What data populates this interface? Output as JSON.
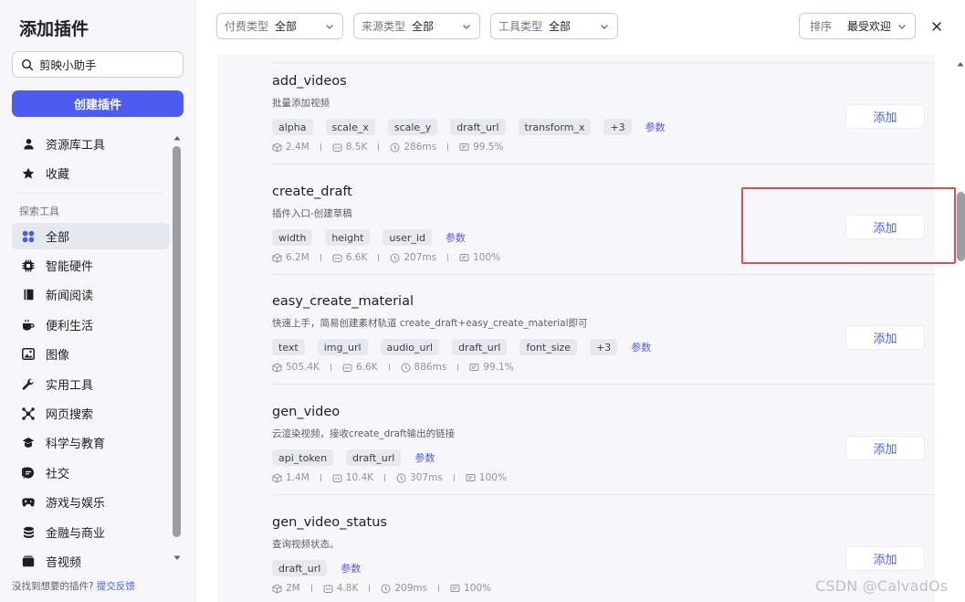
{
  "sidebar": {
    "title": "添加插件",
    "search_value": "剪映小助手",
    "create_label": "创建插件",
    "items_top": [
      {
        "label": "资源库工具",
        "icon": "person-icon"
      },
      {
        "label": "收藏",
        "icon": "star-icon"
      }
    ],
    "section_label": "探索工具",
    "categories": [
      {
        "label": "全部",
        "icon": "grid-icon",
        "active": true
      },
      {
        "label": "智能硬件",
        "icon": "chip-icon"
      },
      {
        "label": "新闻阅读",
        "icon": "book-icon"
      },
      {
        "label": "便利生活",
        "icon": "cup-icon"
      },
      {
        "label": "图像",
        "icon": "image-icon"
      },
      {
        "label": "实用工具",
        "icon": "wrench-icon"
      },
      {
        "label": "网页搜索",
        "icon": "network-icon"
      },
      {
        "label": "科学与教育",
        "icon": "flask-icon"
      },
      {
        "label": "社交",
        "icon": "chat-icon"
      },
      {
        "label": "游戏与娱乐",
        "icon": "gamepad-icon"
      },
      {
        "label": "金融与商业",
        "icon": "coins-icon"
      },
      {
        "label": "音视频",
        "icon": "media-icon"
      }
    ],
    "footer_text": "没找到想要的插件?",
    "footer_link": "提交反馈"
  },
  "filters": [
    {
      "label": "付费类型",
      "value": "全部"
    },
    {
      "label": "来源类型",
      "value": "全部"
    },
    {
      "label": "工具类型",
      "value": "全部"
    }
  ],
  "sort": {
    "label": "排序",
    "value": "最受欢迎"
  },
  "plugins": [
    {
      "name": "add_videos",
      "desc": "批量添加视频",
      "tags": [
        "alpha",
        "scale_x",
        "scale_y",
        "draft_url",
        "transform_x"
      ],
      "more": "+3",
      "params": "参数",
      "stats": {
        "downloads": "2.4M",
        "bots": "8.5K",
        "latency": "286ms",
        "success": "99.5%"
      },
      "add": "添加"
    },
    {
      "name": "create_draft",
      "desc": "插件入口-创建草稿",
      "tags": [
        "width",
        "height",
        "user_id"
      ],
      "more": "",
      "params": "参数",
      "stats": {
        "downloads": "6.2M",
        "bots": "6.6K",
        "latency": "207ms",
        "success": "100%"
      },
      "add": "添加"
    },
    {
      "name": "easy_create_material",
      "desc": "快速上手，简易创建素材轨道 create_draft+easy_create_material即可",
      "tags": [
        "text",
        "img_url",
        "audio_url",
        "draft_url",
        "font_size"
      ],
      "more": "+3",
      "params": "参数",
      "stats": {
        "downloads": "505.4K",
        "bots": "6.6K",
        "latency": "886ms",
        "success": "99.1%"
      },
      "add": "添加"
    },
    {
      "name": "gen_video",
      "desc": "云渲染视频，接收create_draft输出的链接",
      "tags": [
        "api_token",
        "draft_url"
      ],
      "more": "",
      "params": "参数",
      "stats": {
        "downloads": "1.4M",
        "bots": "10.4K",
        "latency": "307ms",
        "success": "100%"
      },
      "add": "添加"
    },
    {
      "name": "gen_video_status",
      "desc": "查询视频状态。",
      "tags": [
        "draft_url"
      ],
      "more": "",
      "params": "参数",
      "stats": {
        "downloads": "2M",
        "bots": "4.8K",
        "latency": "209ms",
        "success": "100%"
      },
      "add": "添加"
    }
  ],
  "watermark": "CSDN @CalvadOs",
  "colors": {
    "accent": "#4c5cf0",
    "highlight_border": "#e14b53",
    "panel_bg": "#f7f7fa"
  }
}
